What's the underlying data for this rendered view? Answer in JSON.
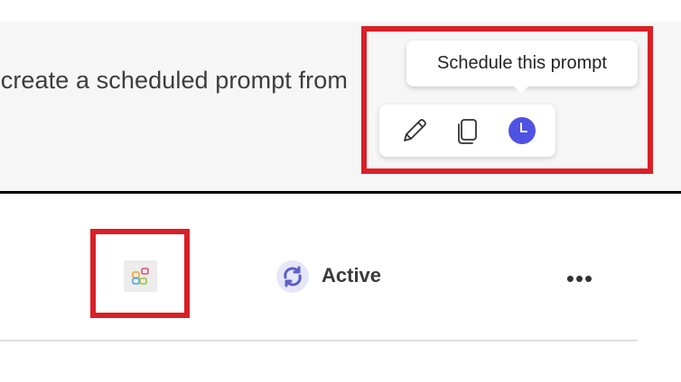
{
  "prompt": {
    "text": "e create a scheduled prompt from"
  },
  "tooltip": {
    "text": "Schedule this prompt"
  },
  "toolbar": {
    "edit_icon": "pencil-icon",
    "copy_icon": "copy-icon",
    "schedule_icon": "clock-icon"
  },
  "row": {
    "app_icon": "app-grid-icon",
    "status": "Active",
    "status_icon": "sync-icon",
    "more_label": "•••"
  },
  "colors": {
    "highlight": "#d92027",
    "schedule_accent": "#4f52e3",
    "status_accent": "#5b5fc7"
  }
}
